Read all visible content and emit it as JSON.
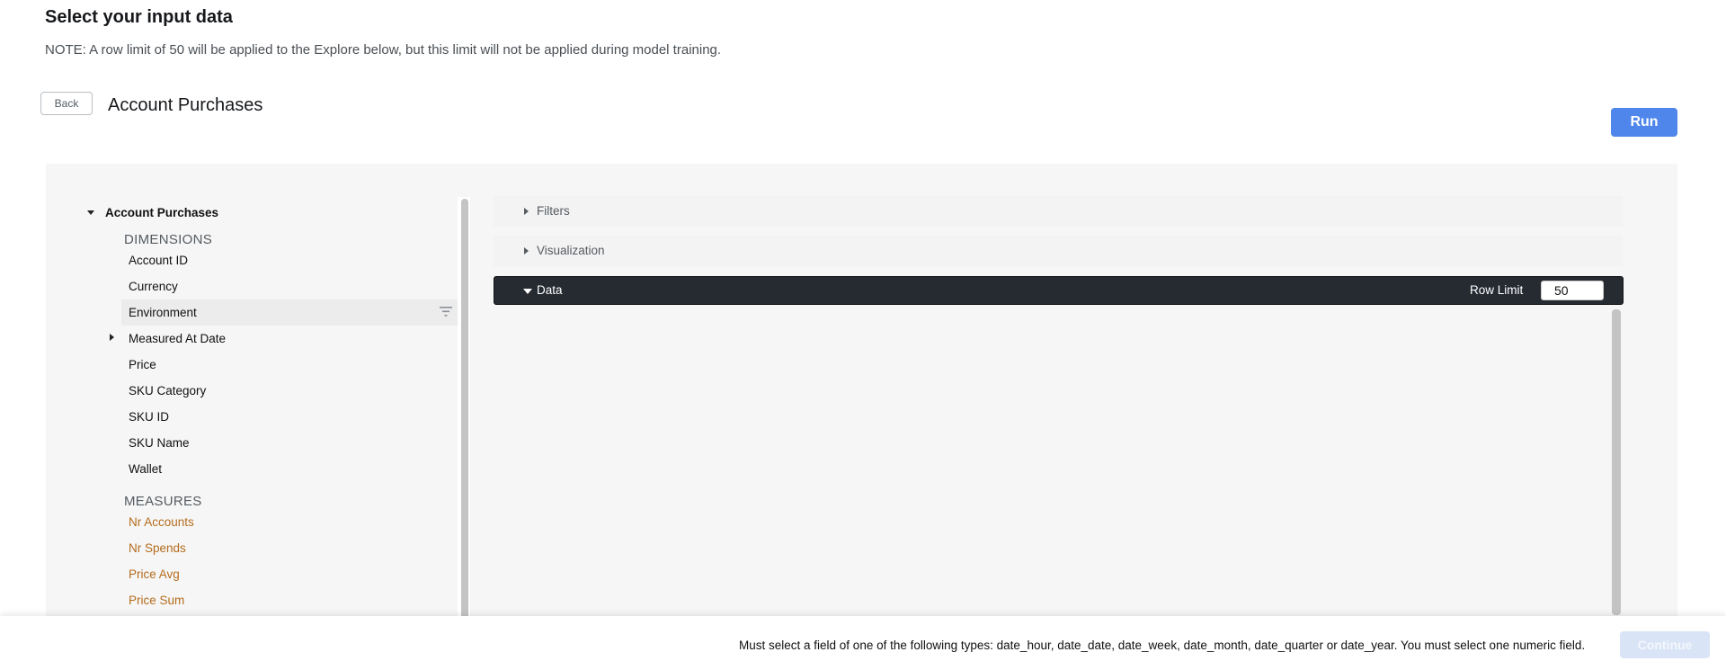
{
  "page": {
    "title": "Select your input data",
    "note": "NOTE: A row limit of 50 will be applied to the Explore below, but this limit will not be applied during model training."
  },
  "header": {
    "back_label": "Back",
    "explore_title": "Account Purchases",
    "run_label": "Run"
  },
  "picker": {
    "explore_name": "Account Purchases",
    "dimensions_label": "DIMENSIONS",
    "dimensions": [
      "Account ID",
      "Currency",
      "Environment",
      "Measured At Date",
      "Price",
      "SKU Category",
      "SKU ID",
      "SKU Name",
      "Wallet"
    ],
    "measures_label": "MEASURES",
    "measures": [
      "Nr Accounts",
      "Nr Spends",
      "Price Avg",
      "Price Sum"
    ]
  },
  "sections": {
    "filters_label": "Filters",
    "visualization_label": "Visualization",
    "data_label": "Data",
    "row_limit_label": "Row Limit",
    "row_limit_value": "50"
  },
  "footer": {
    "message": "Must select a field of one of the following types: date_hour, date_date, date_week, date_month, date_quarter or date_year. You must select one numeric field.",
    "continue_label": "Continue"
  },
  "colors": {
    "accent": "#4e86ec",
    "measure": "#b46c1e",
    "data_bar": "#262b32"
  }
}
